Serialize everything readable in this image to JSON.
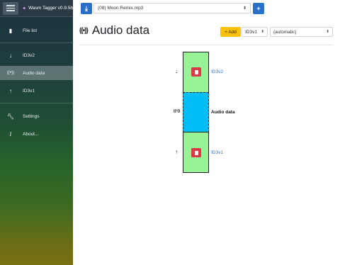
{
  "app": {
    "title": "Wasm Tagger v0.9.5b"
  },
  "sidebar": {
    "items": [
      {
        "label": "File list",
        "icon": "file-icon"
      },
      {
        "label": "ID3v2",
        "icon": "arrow-down-icon"
      },
      {
        "label": "Audio data",
        "icon": "audio-waves-icon"
      },
      {
        "label": "ID3v1",
        "icon": "arrow-up-icon"
      },
      {
        "label": "Settings",
        "icon": "wrench-icon"
      },
      {
        "label": "About...",
        "icon": "info-icon"
      }
    ],
    "active_index": 2
  },
  "toolbar": {
    "selected_file": "(08) Moon Remix.mp3"
  },
  "main": {
    "title": "Audio data",
    "add_label": "+ Add",
    "tag_type": "ID3v1",
    "encoding": "(automatic)"
  },
  "diagram": {
    "blocks": [
      {
        "label": "ID3v2",
        "kind": "tag",
        "color": "#98f397"
      },
      {
        "label": "Audio data",
        "kind": "audio",
        "color": "#00bcf7"
      },
      {
        "label": "ID3v1",
        "kind": "tag",
        "color": "#98f397"
      }
    ]
  },
  "colors": {
    "accent": "#2a70c9",
    "add_button": "#f8c20d",
    "delete_button": "#d93a46"
  }
}
